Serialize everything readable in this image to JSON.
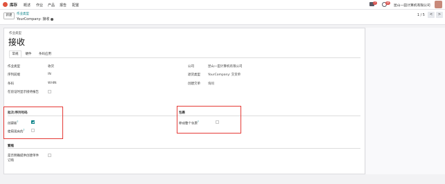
{
  "topbar": {
    "app_name": "库存",
    "menu": [
      "概述",
      "作业",
      "产品",
      "报告",
      "配置"
    ],
    "chat_badge": "7",
    "activity_badge": "18",
    "company": "昆山一田计算机有限公司"
  },
  "control": {
    "new_button": "新建",
    "breadcrumb_parent": "作业类型",
    "breadcrumb_current": "YourCompany: 接收",
    "pager": "1 / 5",
    "prev": "<",
    "next": ">"
  },
  "form": {
    "type_label": "作业类型",
    "title": "接收",
    "tabs": [
      "常规",
      "硬件",
      "条码应用"
    ],
    "left_fields": [
      {
        "label": "作业类型",
        "value": "收货"
      },
      {
        "label": "序列前缀",
        "value": "IN"
      },
      {
        "label": "条码",
        "value": "WHIN"
      },
      {
        "label": "在验证时显示接待报告",
        "value": ""
      }
    ],
    "right_fields": [
      {
        "label": "公司",
        "value": "昆山一田计算机有限公司"
      },
      {
        "label": "退货类型",
        "value": "YourCompany: 交货单"
      },
      {
        "label": "创建欠单",
        "value": "询问"
      }
    ],
    "lots_section": {
      "title": "批次/序列号码",
      "create_new": "创建新",
      "use_existing": "使用现有的",
      "help": "?"
    },
    "packages_section": {
      "title": "包裹",
      "move_entire": "移动整个包裹",
      "help": "?"
    },
    "propagation_section": {
      "title": "繁殖",
      "create_backorder_label_1": "是否明确提供创建单件",
      "create_backorder_label_2": "订购"
    }
  }
}
